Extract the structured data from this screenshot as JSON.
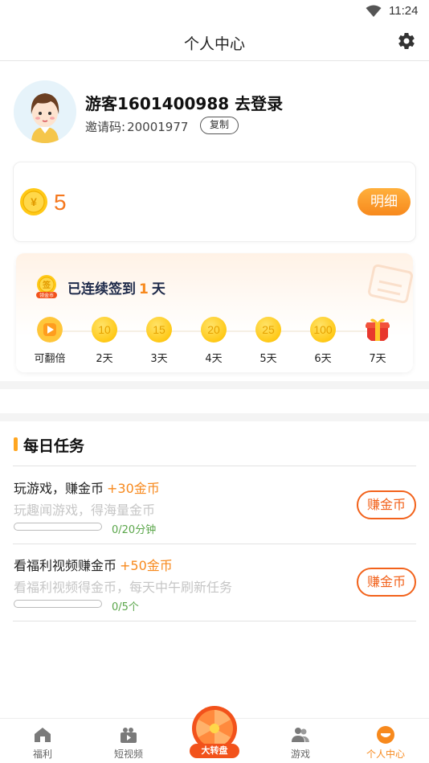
{
  "status_bar": {
    "time": "11:24"
  },
  "header": {
    "title": "个人中心"
  },
  "profile": {
    "username": "游客1601400988 去登录",
    "invite_label": "邀请码:",
    "invite_code": "20001977",
    "copy_label": "复制"
  },
  "coins": {
    "amount": "5",
    "detail_label": "明细"
  },
  "signin": {
    "text_prefix": "已连续签到",
    "days": "1",
    "text_suffix": "天",
    "badge_text": "领金币",
    "items": [
      {
        "value": "",
        "label": "可翻倍",
        "icon": "play-icon"
      },
      {
        "value": "10",
        "label": "2天"
      },
      {
        "value": "15",
        "label": "3天"
      },
      {
        "value": "20",
        "label": "4天"
      },
      {
        "value": "25",
        "label": "5天"
      },
      {
        "value": "100",
        "label": "6天"
      },
      {
        "value": "",
        "label": "7天",
        "icon": "gift-icon"
      }
    ]
  },
  "tasks": {
    "title": "每日任务",
    "items": [
      {
        "title": "玩游戏，赚金币",
        "reward": "+30金币",
        "desc": "玩趣闻游戏，得海量金币",
        "progress_text": "0/20分钟",
        "progress": 0,
        "button": "赚金币"
      },
      {
        "title": "看福利视频赚金币",
        "reward": "+50金币",
        "desc": "看福利视频得金币，每天中午刷新任务",
        "progress_text": "0/5个",
        "progress": 0,
        "button": "赚金币"
      }
    ]
  },
  "bottom_nav": {
    "items": [
      {
        "label": "福利",
        "icon": "home-icon"
      },
      {
        "label": "短视频",
        "icon": "video-icon"
      },
      {
        "label": "大转盘",
        "icon": "wheel-icon"
      },
      {
        "label": "游戏",
        "icon": "game-icon"
      },
      {
        "label": "个人中心",
        "icon": "profile-icon",
        "active": true
      }
    ]
  },
  "colors": {
    "accent": "#f7891d",
    "coin": "#ffc917",
    "earn_button": "#f2621b",
    "progress_text": "#5aa64a"
  }
}
